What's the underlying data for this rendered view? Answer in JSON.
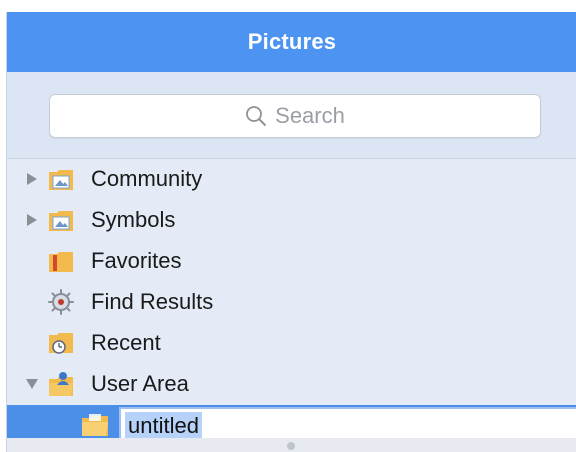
{
  "window": {
    "title": "Pictures"
  },
  "search": {
    "placeholder": "Search"
  },
  "tree": {
    "items": [
      {
        "label": "Community",
        "icon": "picture-folder-icon",
        "disclosure": "collapsed"
      },
      {
        "label": "Symbols",
        "icon": "picture-folder-icon",
        "disclosure": "collapsed"
      },
      {
        "label": "Favorites",
        "icon": "favorites-folder-icon",
        "disclosure": "none"
      },
      {
        "label": "Find Results",
        "icon": "find-results-icon",
        "disclosure": "none"
      },
      {
        "label": "Recent",
        "icon": "recent-folder-icon",
        "disclosure": "none"
      },
      {
        "label": "User Area",
        "icon": "user-folder-icon",
        "disclosure": "expanded"
      },
      {
        "label": "untitled",
        "icon": "folder-icon",
        "disclosure": "none",
        "selected": true,
        "editing": true
      }
    ]
  },
  "colors": {
    "titlebar": "#4d94f2",
    "selection": "#4c8fe8",
    "folder": "#f6c15a",
    "panel": "#e4ebf6"
  }
}
